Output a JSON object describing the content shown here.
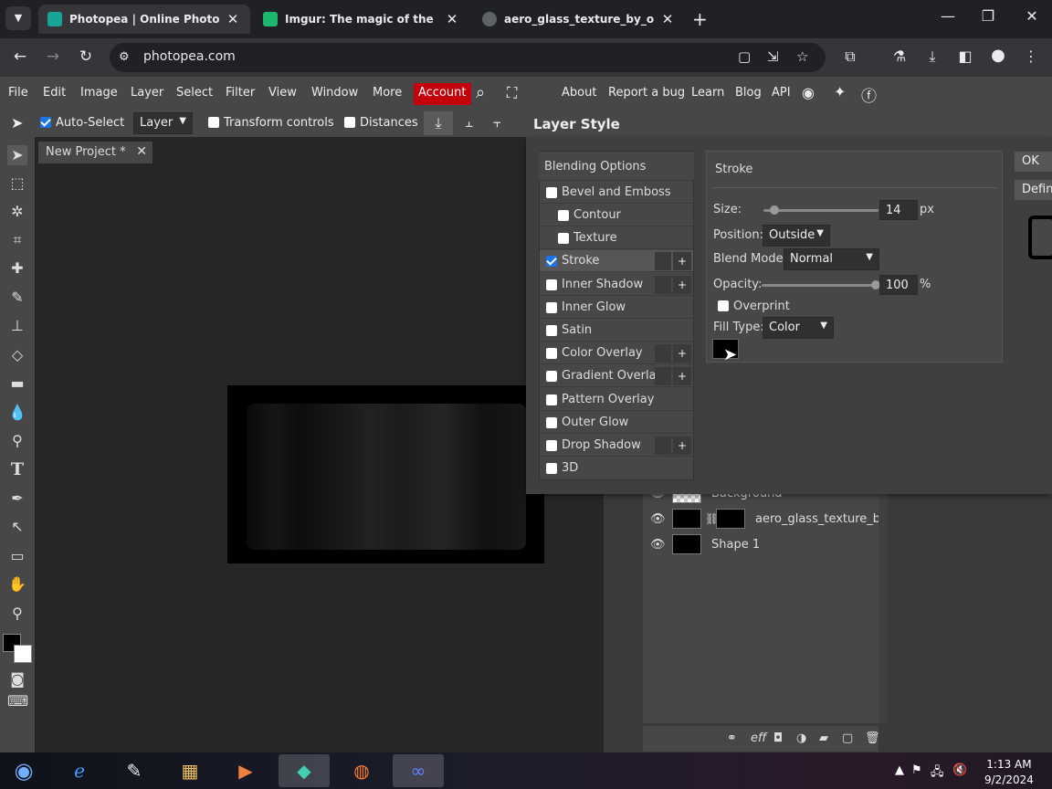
{
  "browser": {
    "tabs": [
      {
        "title": "Photopea | Online Photo Editor",
        "icon_color": "#18a497"
      },
      {
        "title": "Imgur: The magic of the Internet",
        "icon_color": "#1bb76e"
      },
      {
        "title": "aero_glass_texture_by_optimum",
        "icon_color": "#5f6368"
      }
    ],
    "url": "photopea.com"
  },
  "menu": {
    "items": [
      "File",
      "Edit",
      "Image",
      "Layer",
      "Select",
      "Filter",
      "View",
      "Window",
      "More"
    ],
    "account": "Account",
    "right_items": [
      "About",
      "Report a bug",
      "Learn",
      "Blog",
      "API"
    ]
  },
  "options": {
    "auto_select": "Auto-Select",
    "auto_select_target": "Layer",
    "transform_controls": "Transform controls",
    "distances": "Distances"
  },
  "document": {
    "tab": "New Project *"
  },
  "dialog": {
    "title": "Layer Style",
    "blending_header": "Blending Options",
    "effects": [
      {
        "label": "Bevel and Emboss",
        "checked": false,
        "plus": false
      },
      {
        "label": "Contour",
        "checked": false,
        "plus": false,
        "indent": true
      },
      {
        "label": "Texture",
        "checked": false,
        "plus": false,
        "indent": true
      },
      {
        "label": "Stroke",
        "checked": true,
        "plus": true
      },
      {
        "label": "Inner Shadow",
        "checked": false,
        "plus": true
      },
      {
        "label": "Inner Glow",
        "checked": false,
        "plus": false
      },
      {
        "label": "Satin",
        "checked": false,
        "plus": false
      },
      {
        "label": "Color Overlay",
        "checked": false,
        "plus": true
      },
      {
        "label": "Gradient Overlay",
        "checked": false,
        "plus": true
      },
      {
        "label": "Pattern Overlay",
        "checked": false,
        "plus": false
      },
      {
        "label": "Outer Glow",
        "checked": false,
        "plus": false
      },
      {
        "label": "Drop Shadow",
        "checked": false,
        "plus": true
      },
      {
        "label": "3D",
        "checked": false,
        "plus": false
      }
    ],
    "stroke": {
      "header": "Stroke",
      "size_label": "Size:",
      "size_value": "14",
      "size_unit": "px",
      "position_label": "Position:",
      "position_value": "Outside",
      "blend_label": "Blend Mode:",
      "blend_value": "Normal",
      "opacity_label": "Opacity:",
      "opacity_value": "100",
      "opacity_unit": "%",
      "overprint": "Overprint",
      "fill_type_label": "Fill Type:",
      "fill_type_value": "Color",
      "fill_color": "#000000"
    },
    "right_buttons": [
      "OK",
      "Define"
    ]
  },
  "layers": [
    {
      "name": "Background"
    },
    {
      "name": "aero_glass_texture_by_optimum"
    },
    {
      "name": "Shape 1"
    }
  ],
  "taskbar": {
    "time": "1:13 AM",
    "date": "9/2/2024"
  }
}
